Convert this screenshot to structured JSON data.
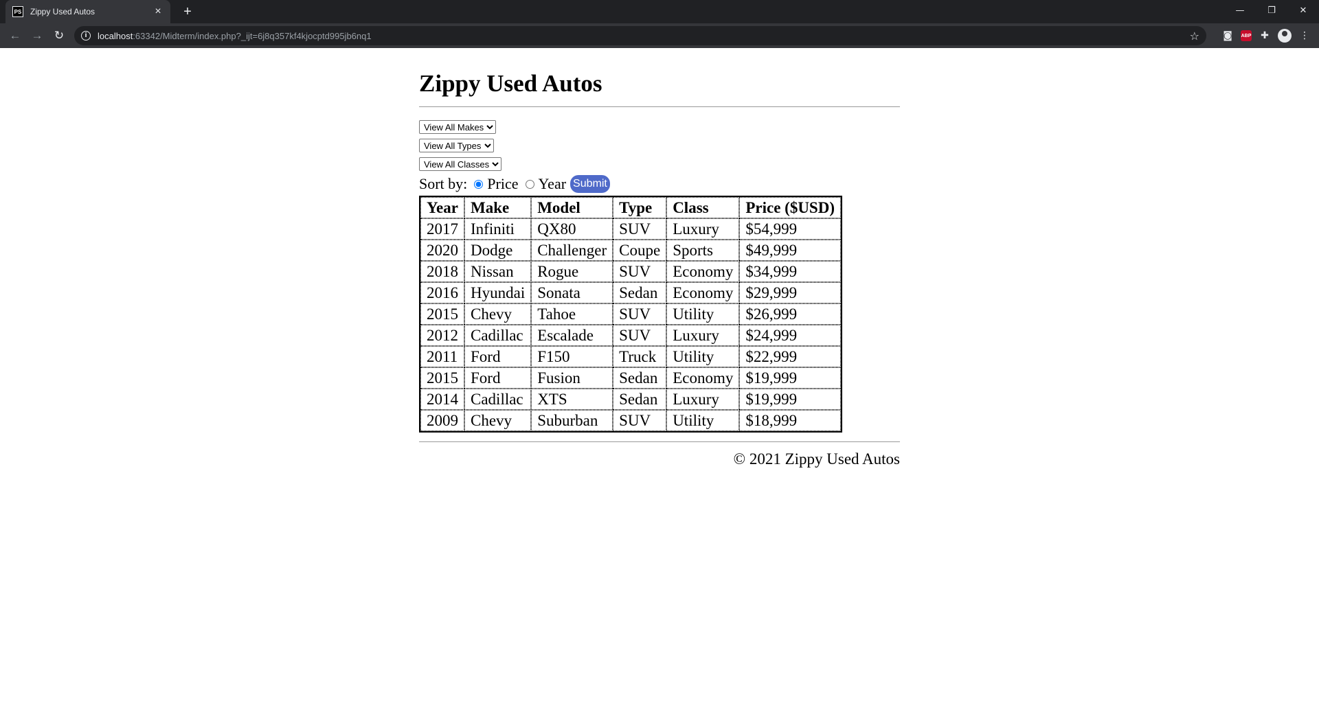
{
  "browser": {
    "tab_title": "Zippy Used Autos",
    "favicon_text": "PS",
    "url_host": "localhost",
    "url_rest": ":63342/Midterm/index.php?_ijt=6j8q357kf4kjocptd995jb6nq1",
    "abp_label": "ABP"
  },
  "page": {
    "title": "Zippy Used Autos",
    "filters": {
      "makes": "View All Makes",
      "types": "View All Types",
      "classes": "View All Classes"
    },
    "sort": {
      "label": "Sort by:",
      "options": [
        "Price",
        "Year"
      ],
      "selected": "Price",
      "submit": "Submit"
    },
    "table": {
      "headers": [
        "Year",
        "Make",
        "Model",
        "Type",
        "Class",
        "Price ($USD)"
      ],
      "rows": [
        [
          "2017",
          "Infiniti",
          "QX80",
          "SUV",
          "Luxury",
          "$54,999"
        ],
        [
          "2020",
          "Dodge",
          "Challenger",
          "Coupe",
          "Sports",
          "$49,999"
        ],
        [
          "2018",
          "Nissan",
          "Rogue",
          "SUV",
          "Economy",
          "$34,999"
        ],
        [
          "2016",
          "Hyundai",
          "Sonata",
          "Sedan",
          "Economy",
          "$29,999"
        ],
        [
          "2015",
          "Chevy",
          "Tahoe",
          "SUV",
          "Utility",
          "$26,999"
        ],
        [
          "2012",
          "Cadillac",
          "Escalade",
          "SUV",
          "Luxury",
          "$24,999"
        ],
        [
          "2011",
          "Ford",
          "F150",
          "Truck",
          "Utility",
          "$22,999"
        ],
        [
          "2015",
          "Ford",
          "Fusion",
          "Sedan",
          "Economy",
          "$19,999"
        ],
        [
          "2014",
          "Cadillac",
          "XTS",
          "Sedan",
          "Luxury",
          "$19,999"
        ],
        [
          "2009",
          "Chevy",
          "Suburban",
          "SUV",
          "Utility",
          "$18,999"
        ]
      ]
    },
    "footer": "© 2021 Zippy Used Autos"
  }
}
